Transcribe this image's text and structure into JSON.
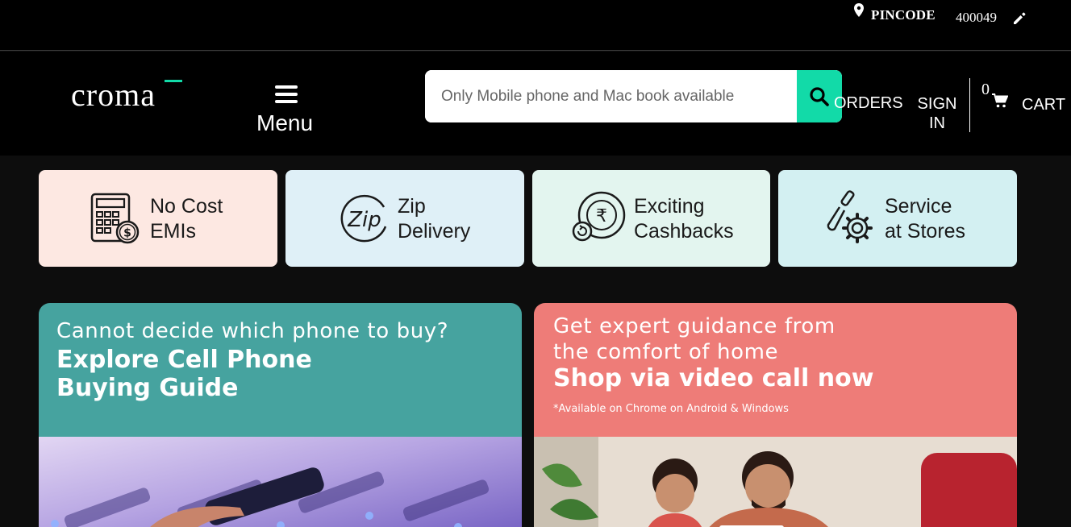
{
  "topbar": {
    "pincode_label": "PINCODE",
    "pincode_value": "400049",
    "icons": [
      "location-pin-icon",
      "pencil-icon"
    ]
  },
  "header": {
    "logo_text": "croma",
    "menu_label": "Menu",
    "search": {
      "placeholder": "Only Mobile phone and Mac book available",
      "value": ""
    },
    "orders_label": "ORDERS",
    "signin_label": "SIGN IN",
    "cart_count": "0",
    "cart_label": "CART"
  },
  "features": [
    {
      "line1": "No Cost",
      "line2": "EMIs",
      "icon": "calculator-icon",
      "bg": "#fde8e2"
    },
    {
      "line1": "Zip",
      "line2": "Delivery",
      "icon": "zip-delivery-icon",
      "bg": "#dff0f7"
    },
    {
      "line1": "Exciting",
      "line2": "Cashbacks",
      "icon": "rupee-cashback-icon",
      "bg": "#e3f5ef"
    },
    {
      "line1": "Service",
      "line2": "at Stores",
      "icon": "tools-gear-icon",
      "bg": "#d3f0f2"
    }
  ],
  "promos": [
    {
      "subtitle": "Cannot decide which phone to buy?",
      "title_line1": "Explore Cell Phone",
      "title_line2": "Buying Guide",
      "bg": "#46a39f"
    },
    {
      "subtitle_line1": "Get expert guidance from",
      "subtitle_line2": "the comfort of home",
      "title": "Shop via video call now",
      "note": "*Available on Chrome on Android & Windows",
      "bg": "#ee7c78"
    }
  ],
  "colors": {
    "accent": "#12daa8",
    "header_bg": "#000000",
    "page_bg": "#0d0d0d"
  }
}
